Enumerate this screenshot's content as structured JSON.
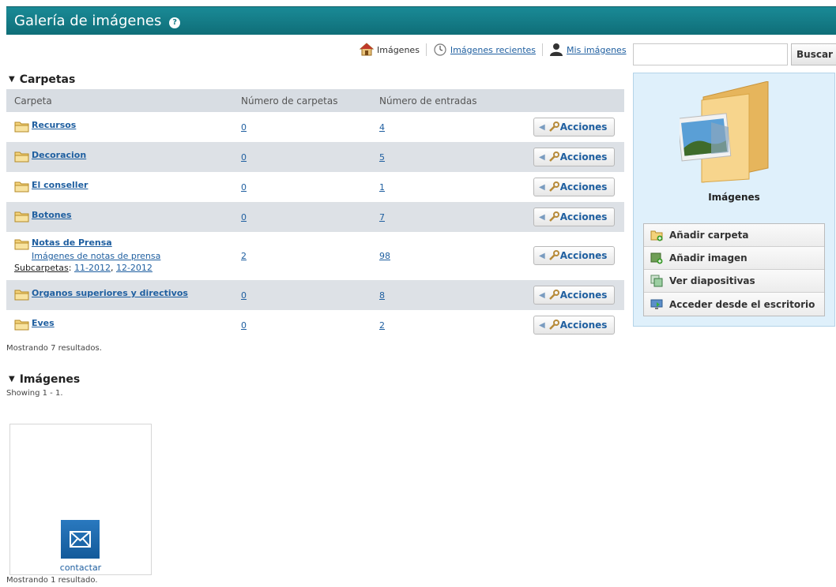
{
  "header": {
    "title": "Galería de imágenes",
    "help_icon": "help-icon"
  },
  "topnav": {
    "home_label": "Imágenes",
    "recent_label": "Imágenes recientes",
    "mine_label": "Mis imágenes"
  },
  "search": {
    "value": "",
    "button_label": "Buscar"
  },
  "folders_section": {
    "title": "Carpetas",
    "columns": [
      "Carpeta",
      "Número de carpetas",
      "Número de entradas"
    ],
    "rows": [
      {
        "name": "Recursos",
        "folders": "0",
        "entries": "4",
        "action": "Acciones"
      },
      {
        "name": "Decoracion",
        "folders": "0",
        "entries": "5",
        "action": "Acciones"
      },
      {
        "name": "El conseller",
        "folders": "0",
        "entries": "1",
        "action": "Acciones"
      },
      {
        "name": "Botones",
        "folders": "0",
        "entries": "7",
        "action": "Acciones"
      },
      {
        "name": "Notas de Prensa",
        "description": "Imágenes de notas de prensa",
        "subfolders_label": "Subcarpetas",
        "subfolders": [
          "11-2012",
          "12-2012"
        ],
        "folders": "2",
        "entries": "98",
        "action": "Acciones"
      },
      {
        "name": "Organos superiores y directivos",
        "folders": "0",
        "entries": "8",
        "action": "Acciones"
      },
      {
        "name": "Eves",
        "folders": "0",
        "entries": "2",
        "action": "Acciones"
      }
    ],
    "results_text": "Mostrando 7 resultados."
  },
  "images_section": {
    "title": "Imágenes",
    "showing_text": "Showing 1 - 1.",
    "items": [
      {
        "caption": "contactar",
        "icon": "envelope-icon"
      }
    ],
    "results_text": "Mostrando 1 resultado."
  },
  "sidebar": {
    "title": "Imágenes",
    "menu": [
      {
        "label": "Añadir carpeta",
        "icon": "add-folder-icon"
      },
      {
        "label": "Añadir imagen",
        "icon": "add-image-icon"
      },
      {
        "label": "Ver diapositivas",
        "icon": "slideshow-icon"
      },
      {
        "label": "Acceder desde el escritorio",
        "icon": "desktop-access-icon"
      }
    ]
  },
  "colors": {
    "header_bg": "#137c87",
    "row_alt": "#dde1e6",
    "panel_bg": "#dff0fb",
    "link": "#1f5fa0"
  }
}
